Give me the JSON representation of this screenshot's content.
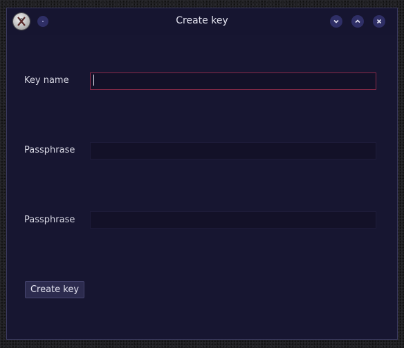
{
  "window": {
    "title": "Create key",
    "icon": "x-app-icon",
    "controls": [
      "menu-icon",
      "minimize-icon",
      "maximize-icon",
      "close-icon"
    ]
  },
  "form": {
    "key_name": {
      "label": "Key name",
      "value": "",
      "placeholder": ""
    },
    "passphrase": {
      "label": "Passphrase",
      "value": "",
      "placeholder": ""
    },
    "passphrase_confirm": {
      "label": "Passphrase",
      "value": "",
      "placeholder": ""
    },
    "submit_label": "Create key"
  },
  "colors": {
    "window_bg": "#171631",
    "focus_border": "#8a2a48",
    "button_bg": "#2c2b4e"
  }
}
